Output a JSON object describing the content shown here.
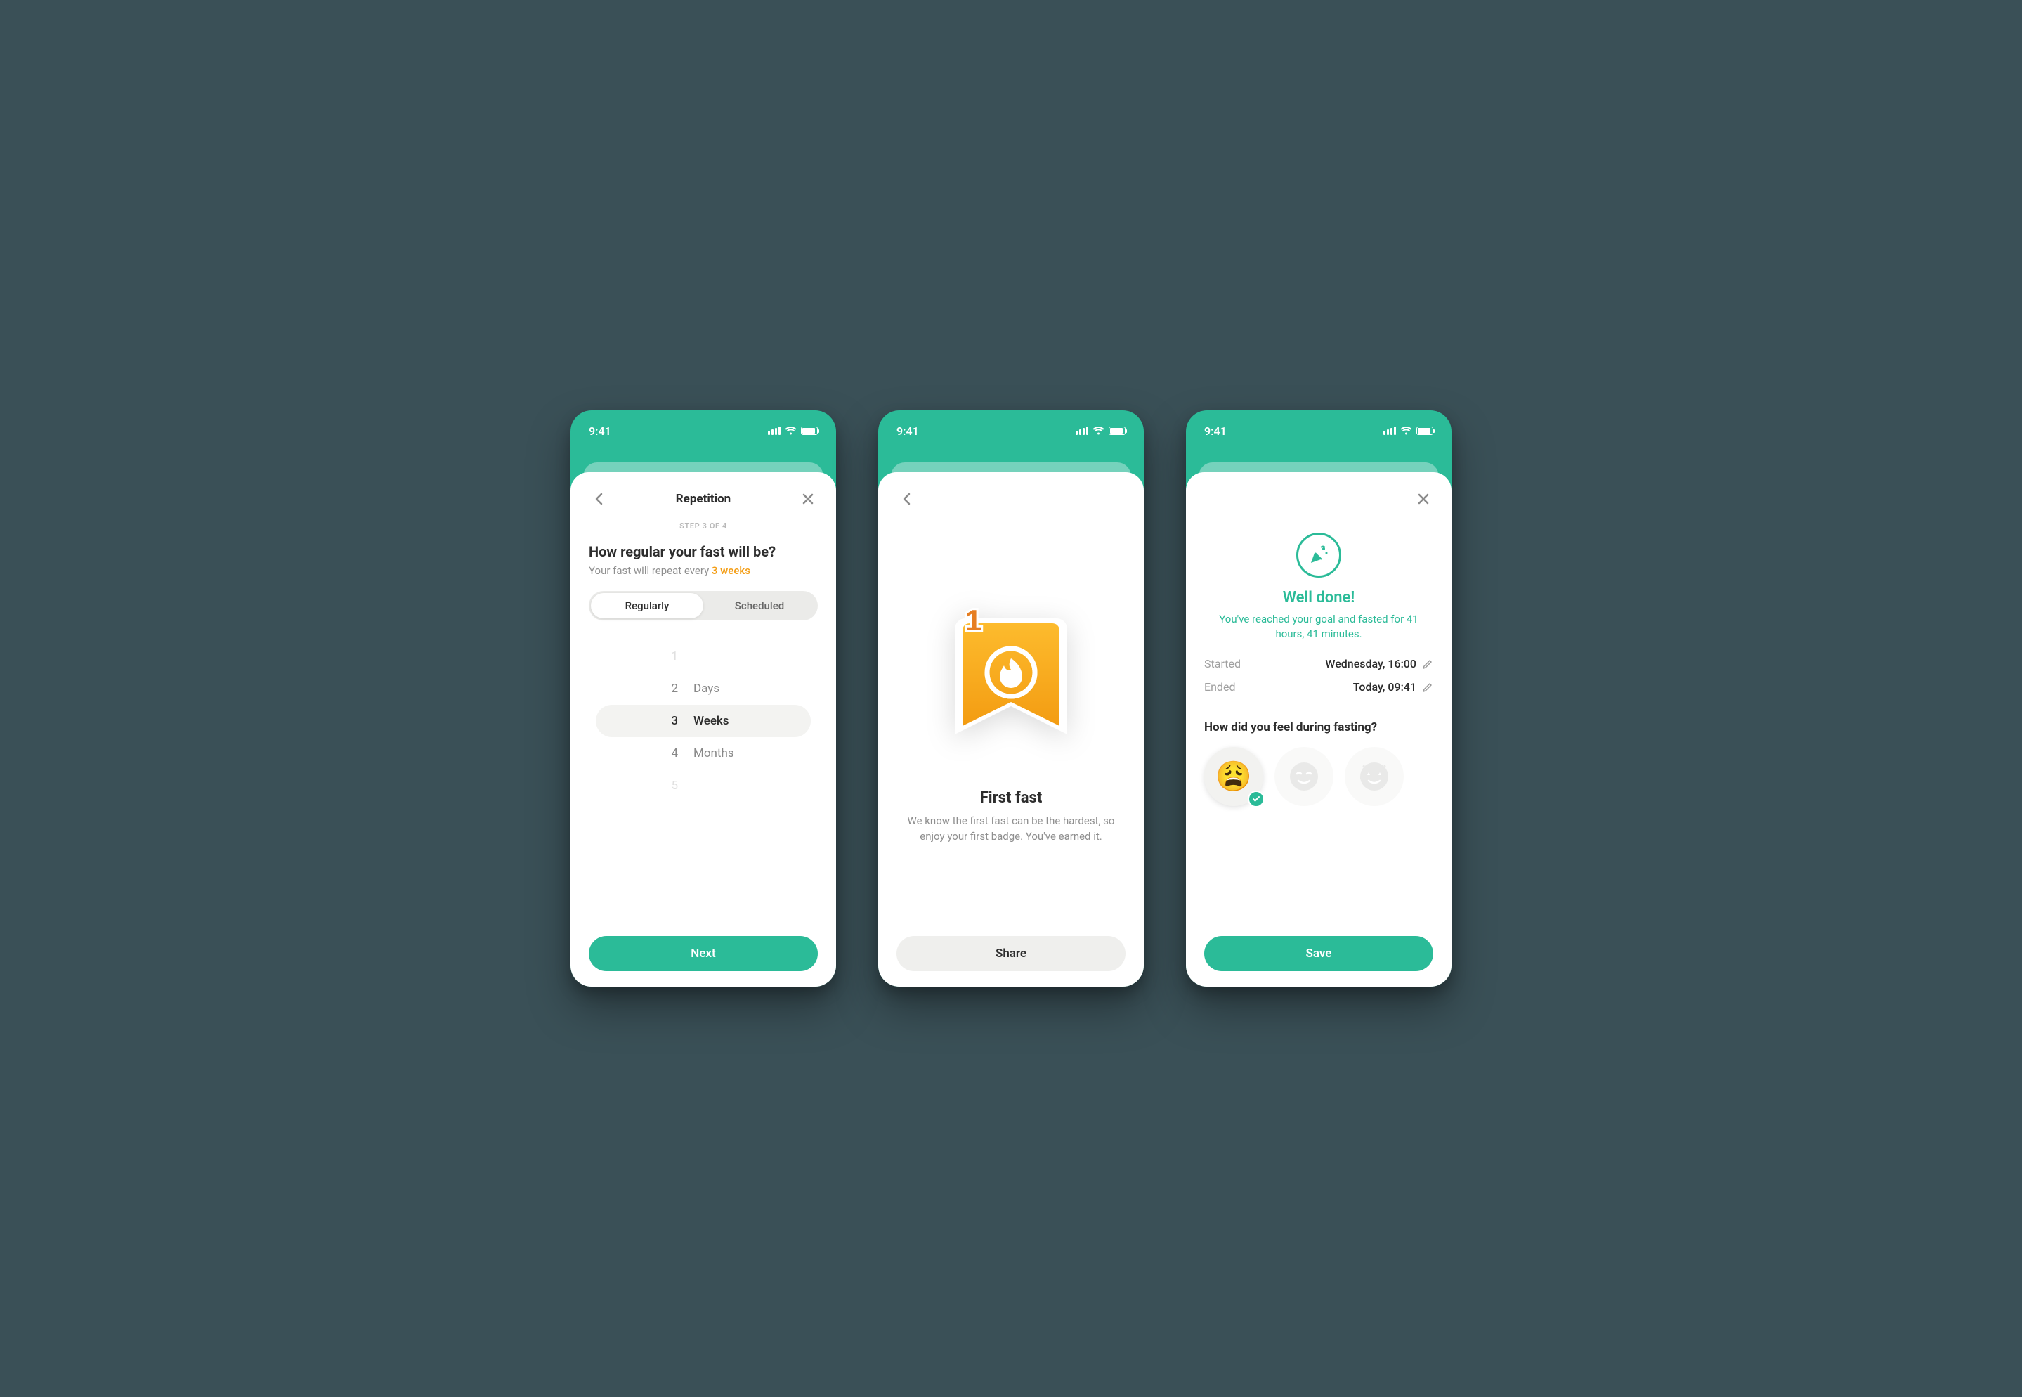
{
  "status": {
    "time": "9:41"
  },
  "screen1": {
    "title": "Repetition",
    "step": "STEP 3 OF 4",
    "question": "How regular your fast will be?",
    "subtitle_prefix": "Your fast will repeat every ",
    "subtitle_value": "3 weeks",
    "segments": {
      "opt1": "Regularly",
      "opt2": "Scheduled"
    },
    "picker": {
      "r1_num": "1",
      "r2_num": "2",
      "r2_lab": "Days",
      "r3_num": "3",
      "r3_lab": "Weeks",
      "r4_num": "4",
      "r4_lab": "Months",
      "r5_num": "5"
    },
    "cta": "Next"
  },
  "screen2": {
    "badge_number": "1",
    "title": "First fast",
    "desc": "We know the first fast can be the hardest, so enjoy your first badge. You've earned it.",
    "cta": "Share"
  },
  "screen3": {
    "title": "Well done!",
    "subtitle": "You've reached your goal and fasted for 41 hours, 41 minutes.",
    "started_label": "Started",
    "started_value": "Wednesday, 16:00",
    "ended_label": "Ended",
    "ended_value": "Today, 09:41",
    "feel_question": "How did you feel during fasting?",
    "cta": "Save"
  }
}
